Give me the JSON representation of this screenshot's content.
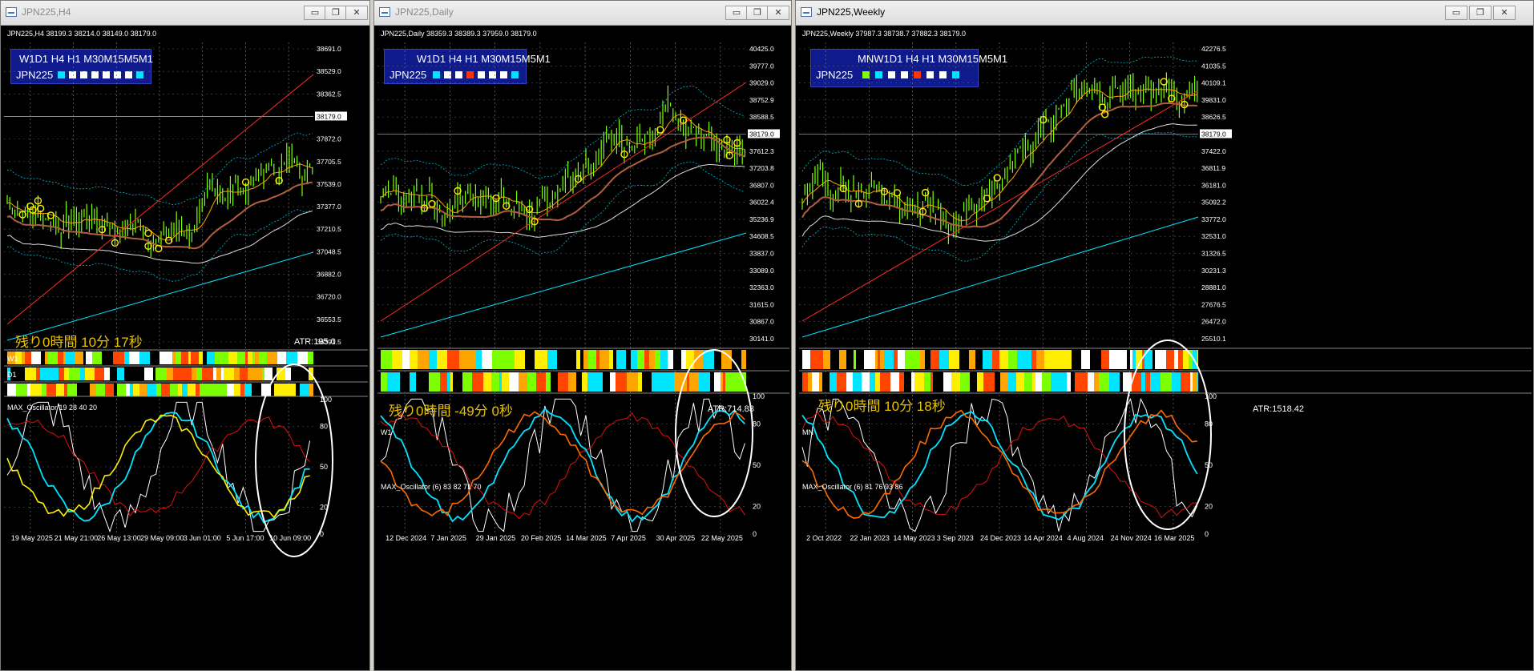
{
  "windows": [
    {
      "title": "JPN225,H4",
      "symbol_line": "JPN225,H4  38199.3 38214.0 38149.0 38179.0",
      "tf_panel": "W1D1 H4 H1 M30M15M5M1",
      "panel_symbol": "JPN225",
      "panel_colors": [
        "#00e5ff",
        "#ffffff",
        "#ffffff",
        "#ffffff",
        "#ffffff",
        "#ffffff",
        "#ffffff",
        "#00e5ff"
      ],
      "timer": "残り0時間 10分 17秒",
      "atr": "ATR:195.0",
      "price_labels": [
        "38691.0",
        "38529.0",
        "38362.5",
        "38179.0",
        "37872.0",
        "37705.5",
        "37539.0",
        "37377.0",
        "37210.5",
        "37048.5",
        "36882.0",
        "36720.0",
        "36553.5",
        "36391.5"
      ],
      "current_price": "38179.0",
      "band_labels": [
        "W1",
        "D1"
      ],
      "band_scale": [
        "1",
        "0",
        "1",
        "0",
        "1",
        "0"
      ],
      "osc_label": "MAX_Oscillator 19 28 40 20",
      "osc_scale": [
        "100",
        "80",
        "50",
        "20",
        "0"
      ],
      "x_labels": [
        "19 May 2025",
        "21 May 21:00",
        "26 May 13:00",
        "29 May 09:00",
        "3 Jun 01:00",
        "5 Jun 17:00",
        "10 Jun 09:00"
      ]
    },
    {
      "title": "JPN225,Daily",
      "symbol_line": "JPN225,Daily  38359.3 38389.3 37959.0 38179.0",
      "tf_panel": "W1D1 H4 H1 M30M15M5M1",
      "panel_symbol": "JPN225",
      "panel_colors": [
        "#00e5ff",
        "#ffffff",
        "#ffffff",
        "#ff3300",
        "#ffffff",
        "#ffffff",
        "#ffffff",
        "#00e5ff"
      ],
      "timer": "残り0時間 -49分 0秒",
      "atr": "ATR:714.83",
      "price_labels": [
        "40425.0",
        "39777.0",
        "39029.0",
        "38752.9",
        "38588.5",
        "38179.0",
        "37612.3",
        "37203.8",
        "36807.0",
        "36022.4",
        "35236.9",
        "34608.5",
        "33837.0",
        "33089.0",
        "32363.0",
        "31615.0",
        "30867.0",
        "30141.0"
      ],
      "current_price": "38179.0",
      "band_labels": [
        "W1"
      ],
      "band_scale": [
        "1",
        "0",
        "1",
        "0"
      ],
      "osc_label": "MAX_Oscillator (6) 83 82 71 70",
      "osc_scale": [
        "100",
        "80",
        "50",
        "20",
        "0"
      ],
      "x_labels": [
        "12 Dec 2024",
        "7 Jan 2025",
        "29 Jan 2025",
        "20 Feb 2025",
        "14 Mar 2025",
        "7 Apr 2025",
        "30 Apr 2025",
        "22 May 2025"
      ]
    },
    {
      "title": "JPN225,Weekly",
      "symbol_line": "JPN225,Weekly  37987.3 38738.7 37882.3 38179.0",
      "tf_panel": "MNW1D1 H4 H1 M30M15M5M1",
      "panel_symbol": "JPN225",
      "panel_colors": [
        "#7cff00",
        "#00e5ff",
        "#ffffff",
        "#ffffff",
        "#ff3300",
        "#ffffff",
        "#ffffff",
        "#00e5ff"
      ],
      "timer": "残り0時間 10分 18秒",
      "atr": "ATR:1518.42",
      "price_labels": [
        "42276.5",
        "41035.5",
        "40109.1",
        "39831.0",
        "38626.5",
        "38179.0",
        "37422.0",
        "36811.9",
        "36181.0",
        "35092.2",
        "33772.0",
        "32531.0",
        "31326.5",
        "30231.3",
        "28881.0",
        "27676.5",
        "26472.0",
        "25510.1"
      ],
      "current_price": "38179.0",
      "band_labels": [
        "MN"
      ],
      "band_scale": [
        "1",
        "0",
        "1",
        "0"
      ],
      "osc_label": "MAX_Oscillator (6) 81 76 93 86",
      "osc_scale": [
        "100",
        "80",
        "50",
        "20",
        "0"
      ],
      "x_labels": [
        "2 Oct 2022",
        "22 Jan 2023",
        "14 May 2023",
        "3 Sep 2023",
        "24 Dec 2023",
        "14 Apr 2024",
        "4 Aug 2024",
        "24 Nov 2024",
        "16 Mar 2025"
      ]
    }
  ],
  "buttons": {
    "minimize": "▭",
    "restore": "❐",
    "close": "✕"
  },
  "colors": {
    "candles": "#7cff00",
    "band_up": "#7cff00",
    "band_down": "#ff4500",
    "band_cyan": "#00e5ff",
    "band_orange": "#ffa500",
    "osc_white": "#ffffff",
    "osc_red": "#e01010",
    "osc_cyan": "#00e5ff",
    "osc_yellow": "#ffee00",
    "osc_orange": "#ff6a00"
  }
}
